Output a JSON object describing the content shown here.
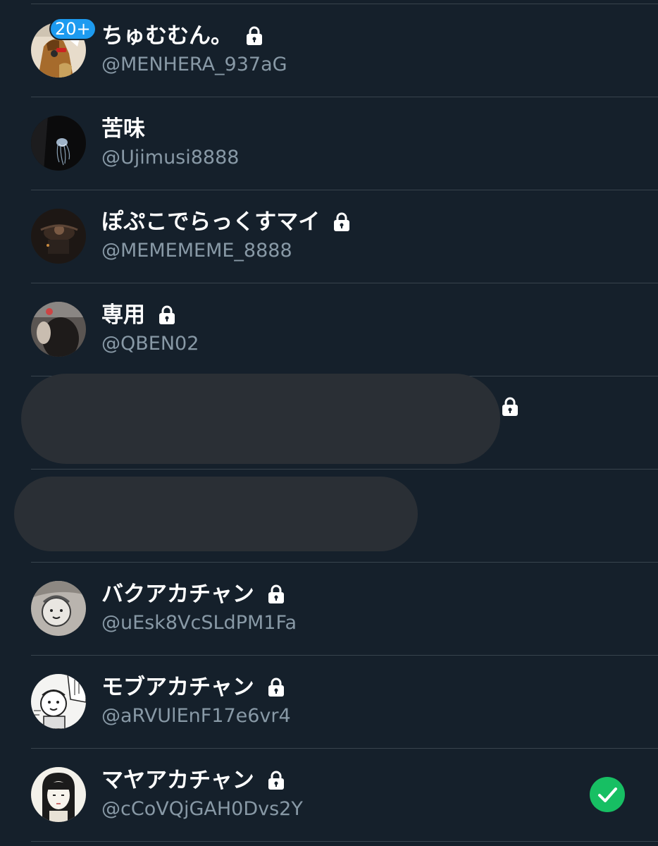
{
  "accounts": [
    {
      "name": "ちゅむむん。",
      "handle": "@MENHERA_937aG",
      "locked": true,
      "badge": "20+",
      "avatar": "avatar-cat-figure"
    },
    {
      "name": "苦味",
      "handle": "@Ujimusi8888",
      "locked": false,
      "avatar": "avatar-jellyfish"
    },
    {
      "name": "ぽぷこでらっくすマイ",
      "handle": "@MEMEMEME_8888",
      "locked": true,
      "avatar": "avatar-dark-photo"
    },
    {
      "name": "専用",
      "handle": "@QBEN02",
      "locked": true,
      "avatar": "avatar-person-photo"
    },
    {
      "redacted": true,
      "locked": true
    },
    {
      "redacted": true,
      "locked": false
    },
    {
      "name": "バクアカチャン",
      "handle": "@uEsk8VcSLdPM1Fa",
      "locked": true,
      "avatar": "avatar-manga-baby-gray"
    },
    {
      "name": "モブアカチャン",
      "handle": "@aRVUlEnF17e6vr4",
      "locked": true,
      "avatar": "avatar-manga-baby"
    },
    {
      "name": "マヤアカチャン",
      "handle": "@cCoVQjGAH0Dvs2Y",
      "locked": true,
      "selected": true,
      "avatar": "avatar-girl-sketch"
    }
  ],
  "icons": {
    "lock": "lock-icon",
    "check": "check-circle-icon"
  },
  "colors": {
    "background": "#15202b",
    "divider": "#38444d",
    "name": "#ffffff",
    "handle": "#8899a6",
    "badge": "#1d9bf0",
    "check": "#17bf63",
    "redaction": "#2a2f35"
  }
}
